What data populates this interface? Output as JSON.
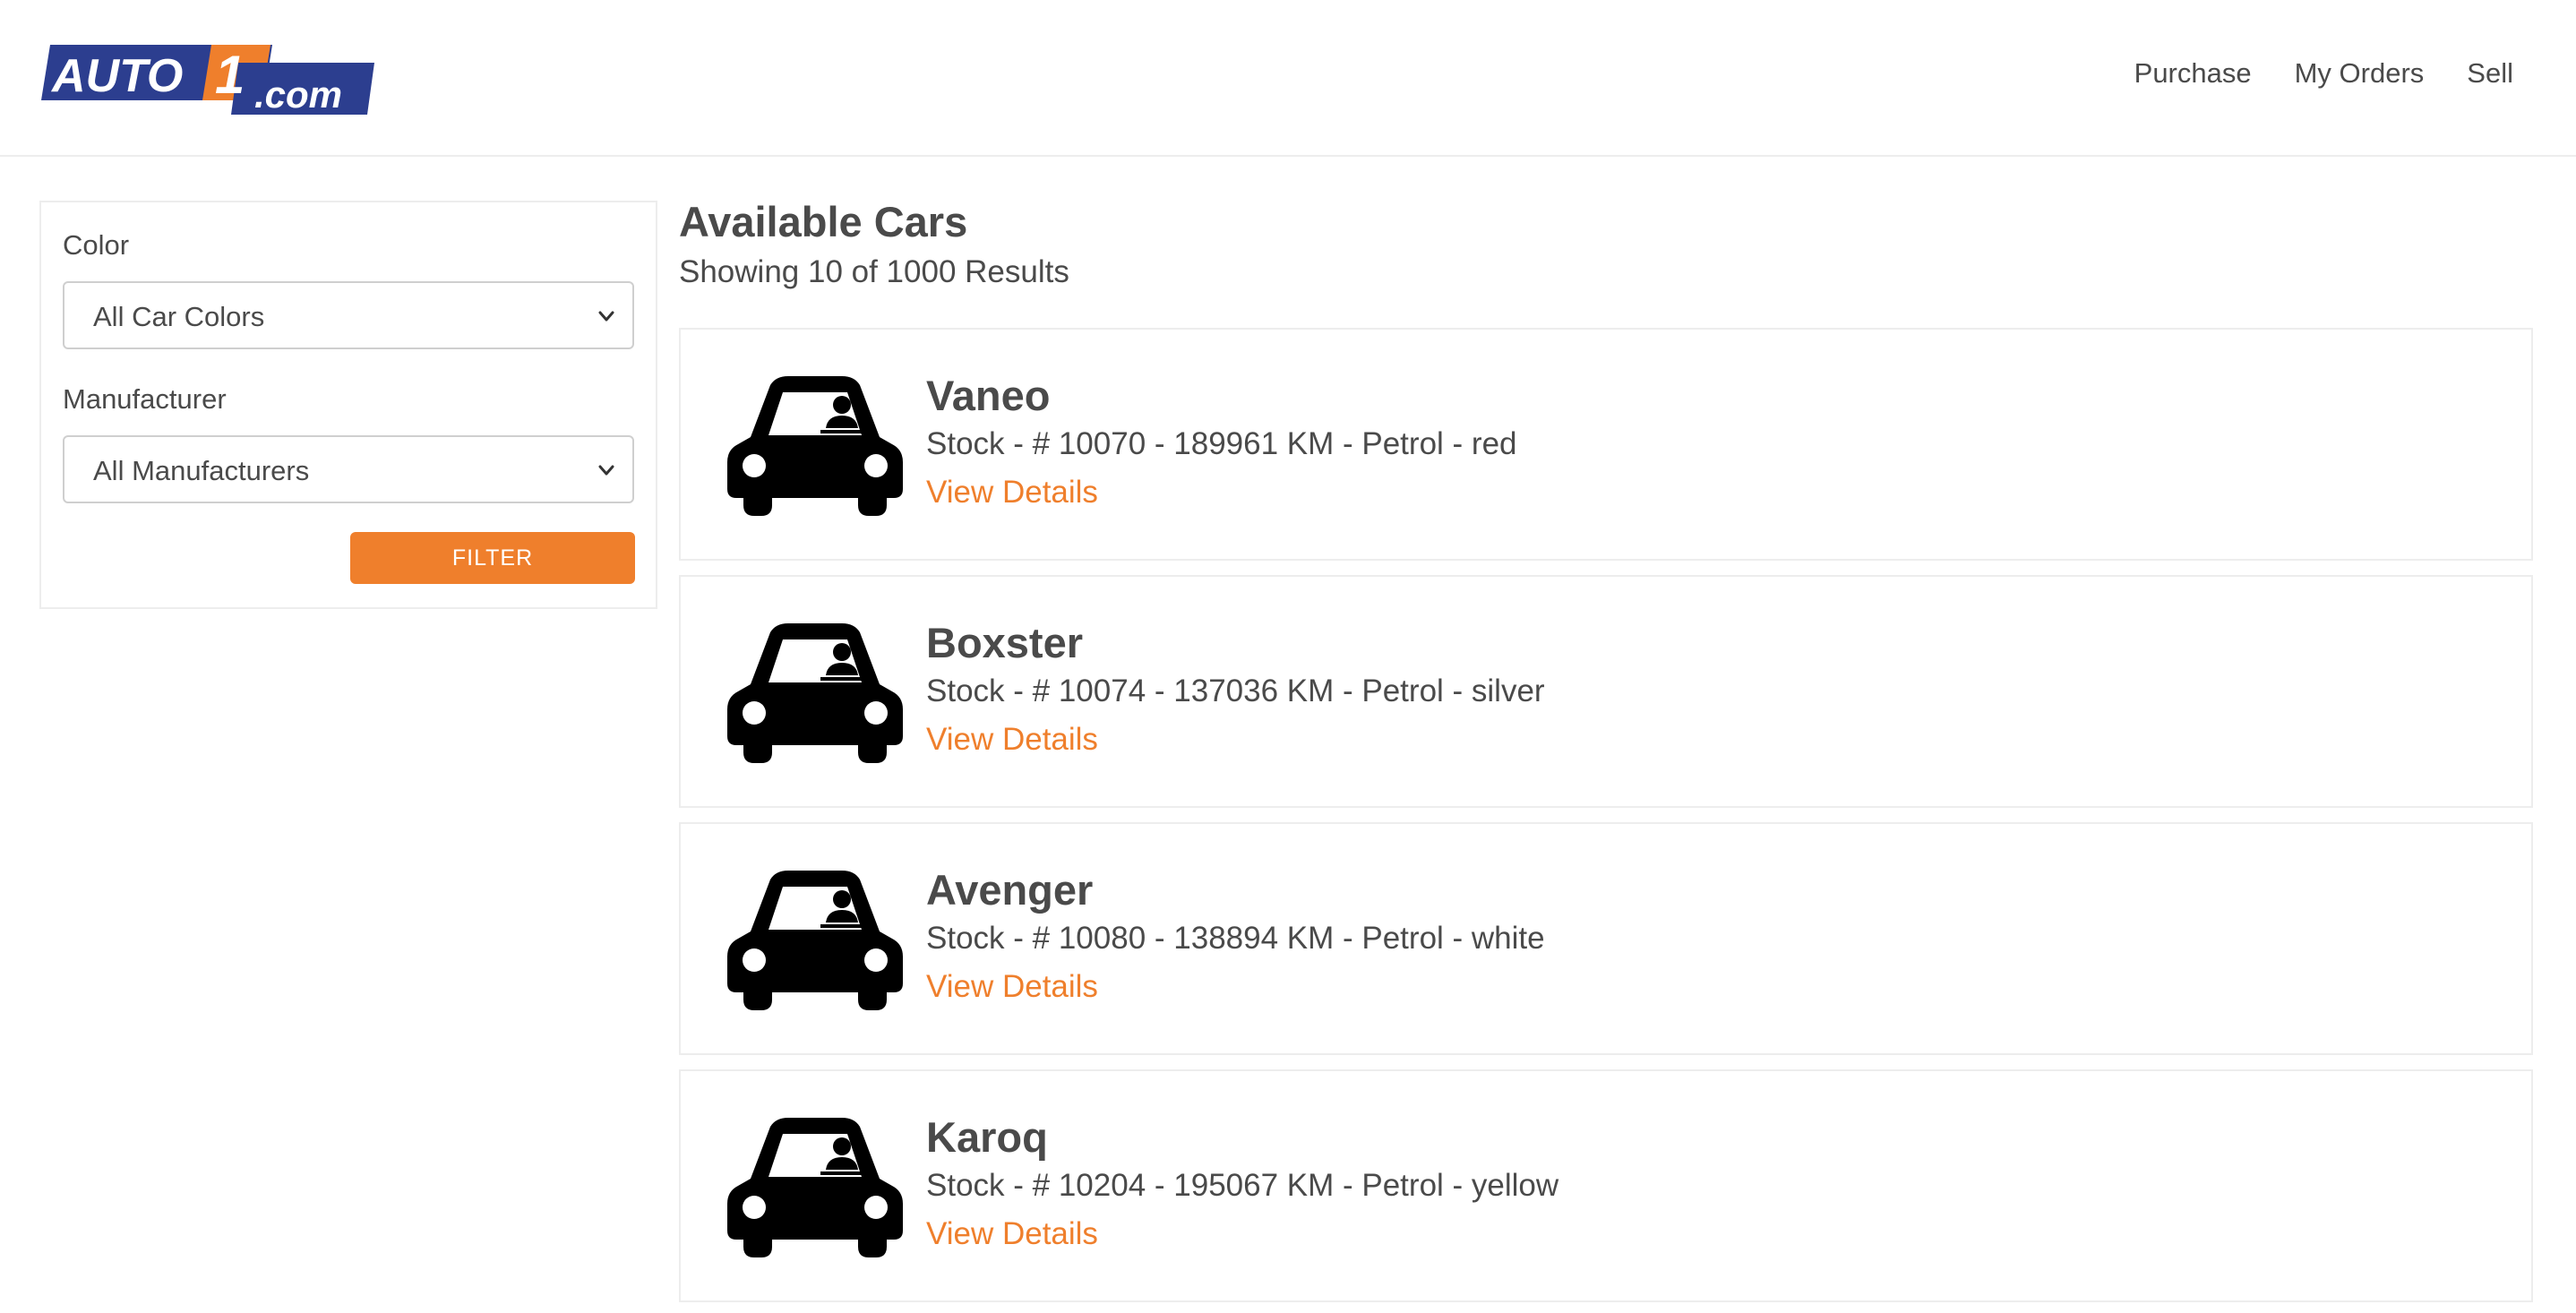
{
  "brand": {
    "logo_text_main": "AUTO",
    "logo_text_one": "1",
    "logo_text_domain": ".com",
    "primary_color": "#2c3e8f",
    "accent_color": "#ef7f2c"
  },
  "nav": {
    "items": [
      {
        "label": "Purchase"
      },
      {
        "label": "My Orders"
      },
      {
        "label": "Sell"
      }
    ]
  },
  "filters": {
    "color_label": "Color",
    "color_value": "All Car Colors",
    "manufacturer_label": "Manufacturer",
    "manufacturer_value": "All Manufacturers",
    "filter_button": "FILTER"
  },
  "main": {
    "title": "Available Cars",
    "results_text": "Showing 10 of 1000 Results"
  },
  "cars": [
    {
      "name": "Vaneo",
      "info": "Stock - # 10070 - 189961 KM - Petrol - red",
      "link": "View Details"
    },
    {
      "name": "Boxster",
      "info": "Stock - # 10074 - 137036 KM - Petrol - silver",
      "link": "View Details"
    },
    {
      "name": "Avenger",
      "info": "Stock - # 10080 - 138894 KM - Petrol - white",
      "link": "View Details"
    },
    {
      "name": "Karoq",
      "info": "Stock - # 10204 - 195067 KM - Petrol - yellow",
      "link": "View Details"
    }
  ]
}
